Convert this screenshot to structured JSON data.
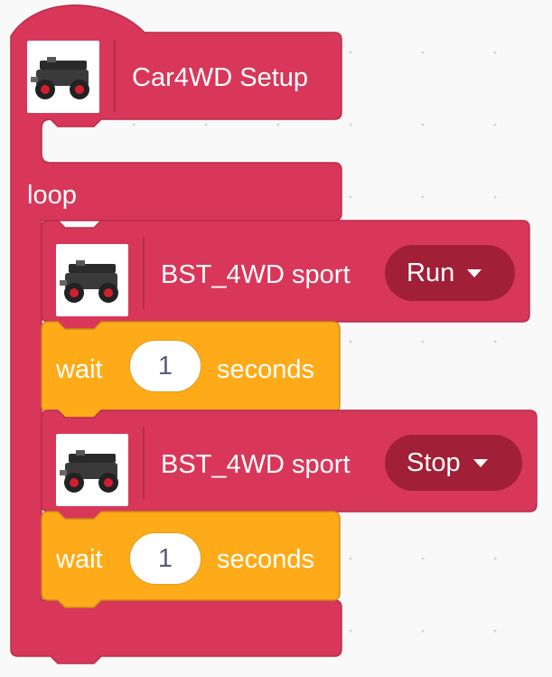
{
  "colors": {
    "robot_block": "#d8375a",
    "robot_block_border": "#b72d4c",
    "robot_dropdown": "#a11f37",
    "control_block": "#ffab19",
    "control_block_border": "#cf8b17",
    "canvas": "#f9f9f9"
  },
  "setup_block": {
    "icon": "robot-car-icon",
    "label": "Car4WD Setup"
  },
  "loop_block": {
    "label": "loop"
  },
  "sport_block_1": {
    "icon": "robot-car-icon",
    "label": "BST_4WD sport",
    "dropdown": "Run"
  },
  "wait_block_1": {
    "label": "wait",
    "value": "1",
    "unit": "seconds"
  },
  "sport_block_2": {
    "icon": "robot-car-icon",
    "label": "BST_4WD sport",
    "dropdown": "Stop"
  },
  "wait_block_2": {
    "label": "wait",
    "value": "1",
    "unit": "seconds"
  }
}
